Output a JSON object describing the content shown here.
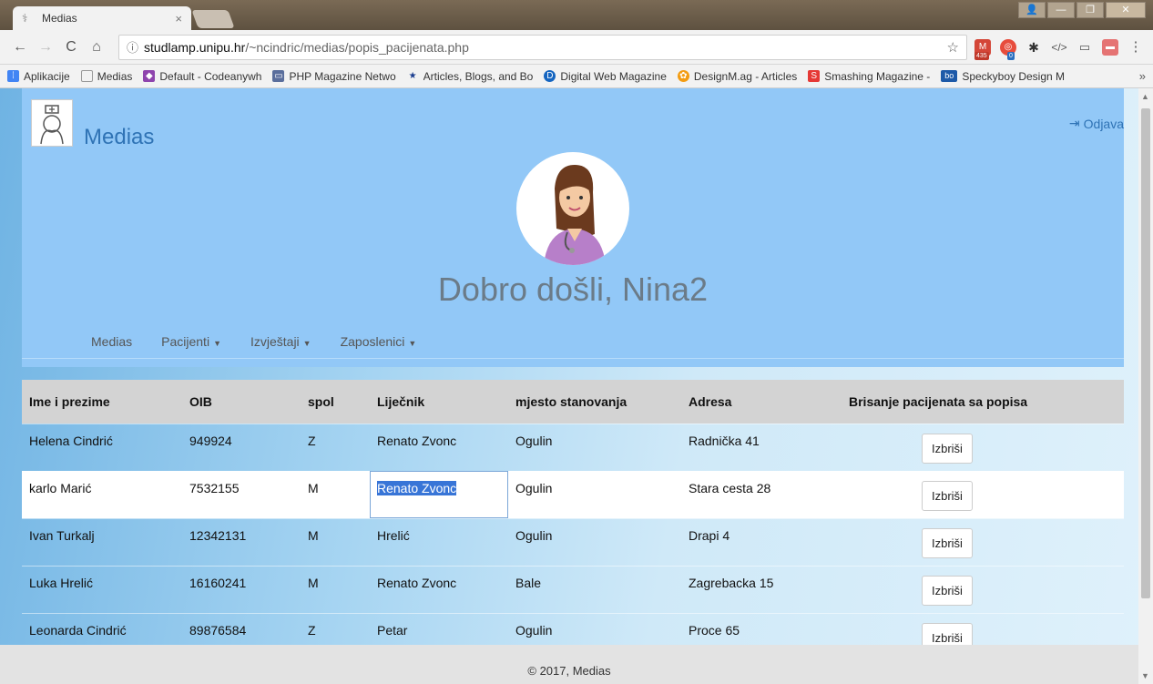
{
  "browser": {
    "tab_title": "Medias",
    "tab_close": "×",
    "url_host": "studlamp.unipu.hr",
    "url_path": "/~ncindric/medias/popis_pacijenata.php",
    "ext_badges": [
      "435",
      "0"
    ],
    "bookmarks": [
      {
        "label": "Aplikacije",
        "icon": "apps-icon"
      },
      {
        "label": "Medias",
        "icon": "page-icon"
      },
      {
        "label": "Default - Codeanywh",
        "icon": "cube-icon"
      },
      {
        "label": "PHP Magazine Netwo",
        "icon": "php-icon"
      },
      {
        "label": "Articles, Blogs, and Bo",
        "icon": "star-icon"
      },
      {
        "label": "Digital Web Magazine",
        "icon": "d-icon"
      },
      {
        "label": "DesignM.ag - Articles",
        "icon": "flower-icon"
      },
      {
        "label": "Smashing Magazine -",
        "icon": "smashing-icon"
      },
      {
        "label": "Speckyboy Design M",
        "icon": "bo-icon"
      }
    ],
    "bookmarks_more": "»"
  },
  "header": {
    "brand": "Medias",
    "logout": "Odjava",
    "welcome": "Dobro došli, Nina2",
    "nav": [
      {
        "label": "Medias",
        "dropdown": false
      },
      {
        "label": "Pacijenti",
        "dropdown": true
      },
      {
        "label": "Izvještaji",
        "dropdown": true
      },
      {
        "label": "Zaposlenici",
        "dropdown": true
      }
    ]
  },
  "table": {
    "columns": [
      "Ime i prezime",
      "OIB",
      "spol",
      "Liječnik",
      "mjesto stanovanja",
      "Adresa",
      "Brisanje pacijenata sa popisa"
    ],
    "delete_label": "Izbriši",
    "rows": [
      {
        "name": "Helena Cindrić",
        "oib": "949924",
        "spol": "Z",
        "lijecnik": "Renato Zvonc",
        "mjesto": "Ogulin",
        "adresa": "Radnička 41"
      },
      {
        "name": "karlo Marić",
        "oib": "7532155",
        "spol": "M",
        "lijecnik": "Renato Zvonc",
        "mjesto": "Ogulin",
        "adresa": "Stara cesta 28"
      },
      {
        "name": "Ivan Turkalj",
        "oib": "12342131",
        "spol": "M",
        "lijecnik": "Hrelić",
        "mjesto": "Ogulin",
        "adresa": "Drapi 4"
      },
      {
        "name": "Luka Hrelić",
        "oib": "16160241",
        "spol": "M",
        "lijecnik": "Renato Zvonc",
        "mjesto": "Bale",
        "adresa": "Zagrebacka 15"
      },
      {
        "name": "Leonarda Cindrić",
        "oib": "89876584",
        "spol": "Z",
        "lijecnik": "Petar",
        "mjesto": "Ogulin",
        "adresa": "Proce 65"
      }
    ]
  },
  "footer": {
    "text": "© 2017, Medias"
  },
  "colors": {
    "header_bg": "#92c8f7",
    "brand": "#2f73b5",
    "selection": "#3875d7"
  }
}
